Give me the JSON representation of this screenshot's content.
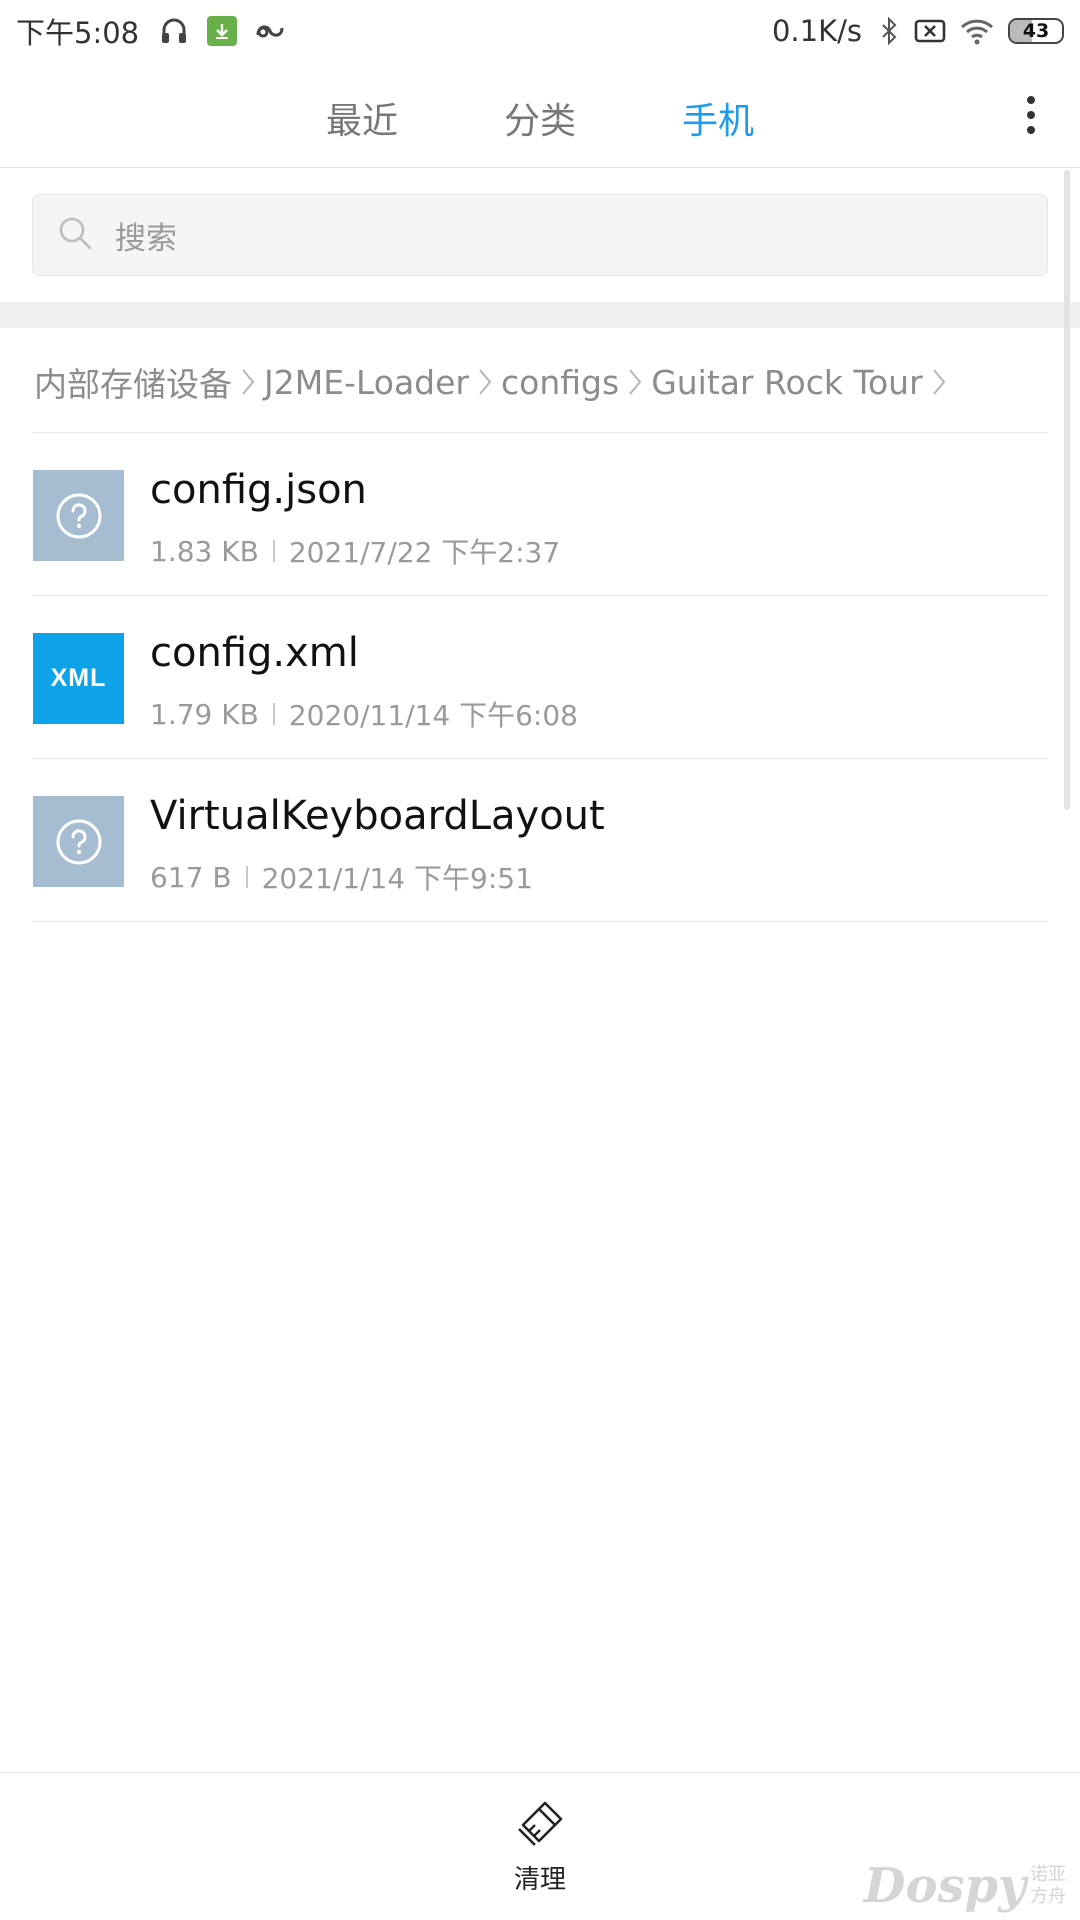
{
  "status_bar": {
    "time": "下午5:08",
    "net_speed": "0.1K/s",
    "battery": "43",
    "battery_level": 0.43,
    "icons": [
      "headphones-icon",
      "download-badge-icon",
      "infinity-icon",
      "bluetooth-icon",
      "sim-off-icon",
      "wifi-icon",
      "battery-icon"
    ]
  },
  "tabs": [
    {
      "label": "最近",
      "active": false
    },
    {
      "label": "分类",
      "active": false
    },
    {
      "label": "手机",
      "active": true
    }
  ],
  "colors": {
    "accent": "#1b9bef",
    "unknown_file_icon": "#a6bcd1",
    "xml_file_icon": "#0ea3e8"
  },
  "search": {
    "placeholder": "搜索"
  },
  "breadcrumb": [
    "内部存储设备",
    "J2ME-Loader",
    "configs",
    "Guitar Rock Tour"
  ],
  "files": [
    {
      "name": "config.json",
      "size": "1.83 KB",
      "date": "2021/7/22 下午2:37",
      "icon": "unknown-file-icon"
    },
    {
      "name": "config.xml",
      "size": "1.79 KB",
      "date": "2020/11/14 下午6:08",
      "icon": "xml-file-icon",
      "icon_label": "XML"
    },
    {
      "name": "VirtualKeyboardLayout",
      "size": "617 B",
      "date": "2021/1/14 下午9:51",
      "icon": "unknown-file-icon"
    }
  ],
  "bottom_bar": {
    "clean_label": "清理"
  },
  "watermark": {
    "text": "Dospy",
    "sub_line1": "诺亚",
    "sub_line2": "方舟"
  }
}
